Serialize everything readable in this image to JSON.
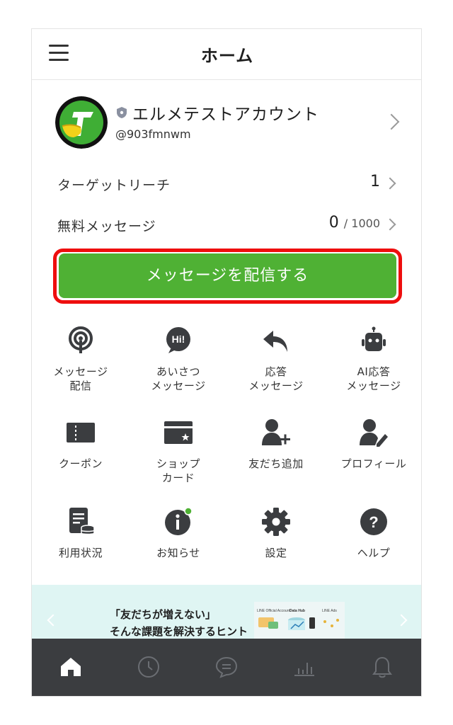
{
  "header": {
    "title": "ホーム",
    "menu_icon": "hamburger-menu-icon"
  },
  "account": {
    "name": "エルメテストアカウント",
    "id": "@903fmnwm",
    "badge_icon": "shield-icon"
  },
  "stats": {
    "target_reach": {
      "label": "ターゲットリーチ",
      "value": "1"
    },
    "free_messages": {
      "label": "無料メッセージ",
      "value": "0",
      "limit": "/ 1000"
    }
  },
  "cta": {
    "label": "メッセージを配信する",
    "color": "#4fb134",
    "highlight": "#ee0e0e"
  },
  "tiles": [
    {
      "label": "メッセージ\n配信",
      "icon": "broadcast-icon"
    },
    {
      "label": "あいさつ\nメッセージ",
      "icon": "greeting-hi-icon"
    },
    {
      "label": "応答\nメッセージ",
      "icon": "reply-arrow-icon"
    },
    {
      "label": "AI応答\nメッセージ",
      "icon": "robot-icon"
    },
    {
      "label": "クーポン",
      "icon": "coupon-icon"
    },
    {
      "label": "ショップ\nカード",
      "icon": "shop-card-icon"
    },
    {
      "label": "友だち追加",
      "icon": "add-friend-icon"
    },
    {
      "label": "プロフィール",
      "icon": "profile-edit-icon"
    },
    {
      "label": "利用状況",
      "icon": "usage-report-icon"
    },
    {
      "label": "お知らせ",
      "icon": "info-notice-icon"
    },
    {
      "label": "設定",
      "icon": "gear-icon"
    },
    {
      "label": "ヘルプ",
      "icon": "help-question-icon"
    }
  ],
  "banner": {
    "text": "「友だちが増えない」\nそんな課題を解決するヒント",
    "image_captions": [
      "LINE Official Account",
      "Data Hub",
      "LINE Ads"
    ]
  },
  "bottom_nav": [
    {
      "name": "home",
      "icon": "home-icon",
      "active": true
    },
    {
      "name": "history",
      "icon": "clock-icon",
      "active": false
    },
    {
      "name": "chat",
      "icon": "chat-bubble-icon",
      "active": false
    },
    {
      "name": "analytics",
      "icon": "bar-chart-icon",
      "active": false
    },
    {
      "name": "notifications",
      "icon": "bell-icon",
      "active": false
    }
  ]
}
